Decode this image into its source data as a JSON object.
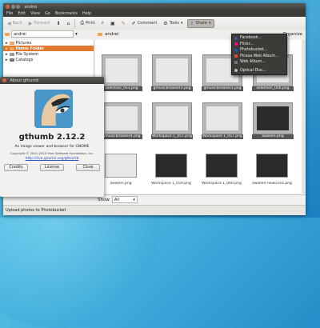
{
  "window": {
    "title": "andrei",
    "controls": {
      "close": "×",
      "minimize": "–",
      "maximize": "□"
    }
  },
  "menu": [
    "File",
    "Edit",
    "View",
    "Go",
    "Bookmarks",
    "Help"
  ],
  "toolbar": {
    "back": "Back",
    "forward": "Forward",
    "print": "Print",
    "comment": "Comment",
    "tools": "Tools",
    "share": "Share"
  },
  "location": {
    "sidebar_combo": "andrei",
    "folder": "andrei",
    "organize": "Organize"
  },
  "sidebar": {
    "items": [
      {
        "label": "Pictures",
        "selected": false
      },
      {
        "label": "Home Folder",
        "selected": true
      },
      {
        "label": "File System",
        "selected": false
      },
      {
        "label": "Catalogs",
        "selected": false
      }
    ]
  },
  "thumbnails": [
    {
      "caption": "selection_053.png",
      "style": "shot"
    },
    {
      "caption": "gmusicbrowser3.png",
      "style": "shot"
    },
    {
      "caption": "gmusicbrowser3.png",
      "style": "shot"
    },
    {
      "caption": "selection_056.png",
      "style": "shot"
    },
    {
      "caption": "gmusicbrowser4.png",
      "style": "shot"
    },
    {
      "caption": "Workspace 1_057.png",
      "style": "shot"
    },
    {
      "caption": "Workspace 1_057.png",
      "style": "shot"
    },
    {
      "caption": "awoken.png",
      "style": "dark"
    },
    {
      "caption": "awoken.png",
      "style": "plain"
    },
    {
      "caption": "Workspace 1_059.png",
      "style": "plain-dark"
    },
    {
      "caption": "Workspace 1_060.png",
      "style": "plain-dark"
    },
    {
      "caption": "awoken-newicons.png",
      "style": "plain-dark"
    }
  ],
  "share_menu": [
    {
      "label": "Facebook...",
      "color": "#3b5998"
    },
    {
      "label": "Flickr...",
      "color": "#ff0084"
    },
    {
      "label": "Photobucket...",
      "color": "#1c5aa6"
    },
    {
      "label": "Picasa Web Album...",
      "color": "#e04b3c"
    },
    {
      "label": "Web Album...",
      "color": "#777777"
    },
    {
      "label": "Optical Disc...",
      "color": "#bbbbbb"
    }
  ],
  "about": {
    "title": "About gthumb",
    "app_name": "gthumb 2.12.2",
    "description": "An image viewer and browser for GNOME",
    "copyright": "Copyright © 2001-2010 Free Software Foundation, Inc.",
    "website": "http://live.gnome.org/gthumb",
    "buttons": {
      "credits": "Credits",
      "license": "License",
      "close": "Close"
    }
  },
  "filter": {
    "label": "Show",
    "value": "All"
  },
  "statusbar": {
    "text": "Upload photos to Photobucket"
  }
}
